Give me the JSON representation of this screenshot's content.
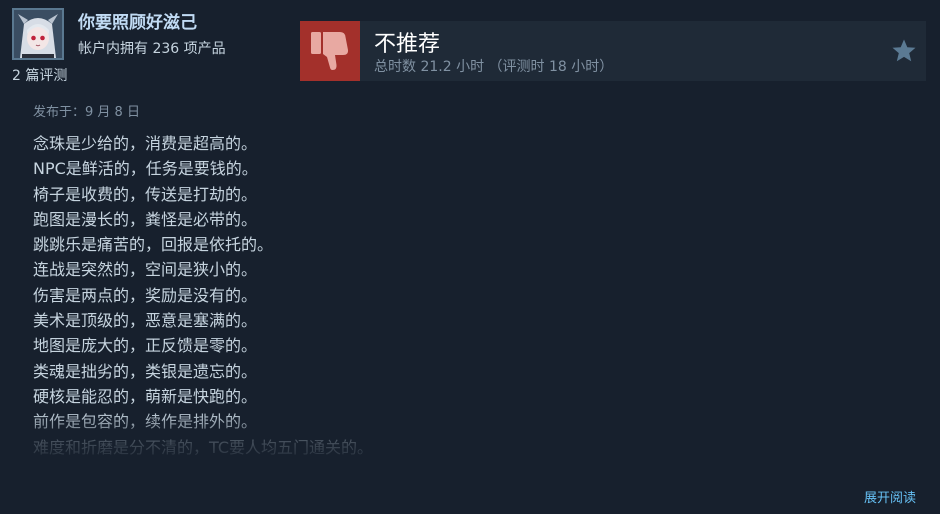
{
  "author": {
    "name": "你要照顾好滋己",
    "products": "帐户内拥有 236 项产品",
    "reviews": "2 篇评测"
  },
  "verdict": {
    "title": "不推荐",
    "hours": "总时数 21.2 小时 （评测时 18 小时）",
    "icon": "thumbs-down-icon",
    "color": "#a3302b"
  },
  "review": {
    "posted": "发布于：9 月 8 日",
    "lines": [
      "念珠是少给的，消费是超高的。",
      "NPC是鲜活的，任务是要钱的。",
      "椅子是收费的，传送是打劫的。",
      "跑图是漫长的，粪怪是必带的。",
      "跳跳乐是痛苦的，回报是依托的。",
      "连战是突然的，空间是狭小的。",
      "伤害是两点的，奖励是没有的。",
      "美术是顶级的，恶意是塞满的。",
      "地图是庞大的，正反馈是零的。",
      "类魂是拙劣的，类银是遗忘的。",
      "硬核是能忍的，萌新是快跑的。",
      "前作是包容的，续作是排外的。",
      "难度和折磨是分不清的，TC要人均五门通关的。"
    ]
  },
  "actions": {
    "expand": "展开阅读"
  },
  "colors": {
    "background": "#17202d",
    "link": "#66c0f4",
    "text": "#c6d4df"
  }
}
